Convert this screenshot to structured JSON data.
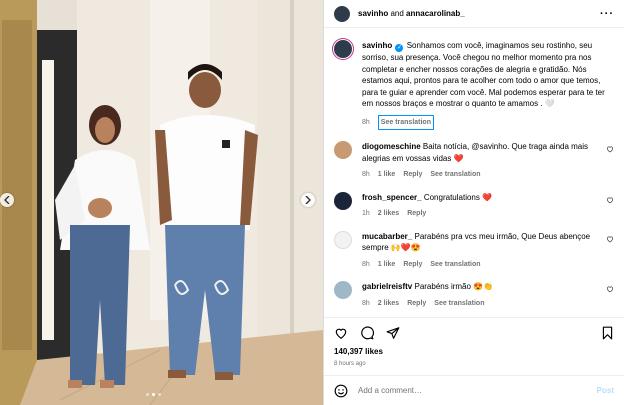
{
  "header": {
    "user1": "savinho",
    "and": " and ",
    "user2": "annacarolinab_",
    "more_icon": "···"
  },
  "caption": {
    "username": "savinho",
    "text": "Sonhamos com você, imaginamos seu rostinho, seu sorriso, sua presença. Você chegou no melhor momento pra nos completar e encher nossos corações de alegria e gratidão. Nós estamos aqui, prontos para te acolher com todo o amor que temos, para te guiar e aprender com você. Mal podemos esperar para te ter em nossos braços e mostrar o quanto te amamos . 🤍",
    "time": "8h",
    "see_translation": "See translation"
  },
  "comments": [
    {
      "username": "diogomeschine",
      "text": "Baita notícia, @savinho. Que traga ainda mais alegrias em vossas vidas ❤️",
      "time": "8h",
      "likes": "1 like",
      "reply": "Reply",
      "see_translation": "See translation",
      "avatar_color": "#c89a72"
    },
    {
      "username": "frosh_spencer_",
      "text": "Congratulations ❤️",
      "time": "1h",
      "likes": "2 likes",
      "reply": "Reply",
      "see_translation": "",
      "avatar_color": "#1c2538"
    },
    {
      "username": "mucabarber_",
      "text": "Parabéns pra vcs meu irmão, Que Deus abençoe sempre 🙌❤️😍",
      "time": "8h",
      "likes": "1 like",
      "reply": "Reply",
      "see_translation": "See translation",
      "avatar_color": "#f2f2f2"
    },
    {
      "username": "gabrielreisftv",
      "text": "Parabéns irmão 😍👏",
      "time": "8h",
      "likes": "2 likes",
      "reply": "Reply",
      "see_translation": "See translation",
      "avatar_color": "#9fb8c8"
    }
  ],
  "likes_count": "140,397 likes",
  "time_ago": "8 hours ago",
  "add_comment": {
    "placeholder": "Add a comment…",
    "post": "Post"
  },
  "colors": {
    "accent": "#0095f6",
    "heart": "#ed4956",
    "muted": "#737373"
  }
}
